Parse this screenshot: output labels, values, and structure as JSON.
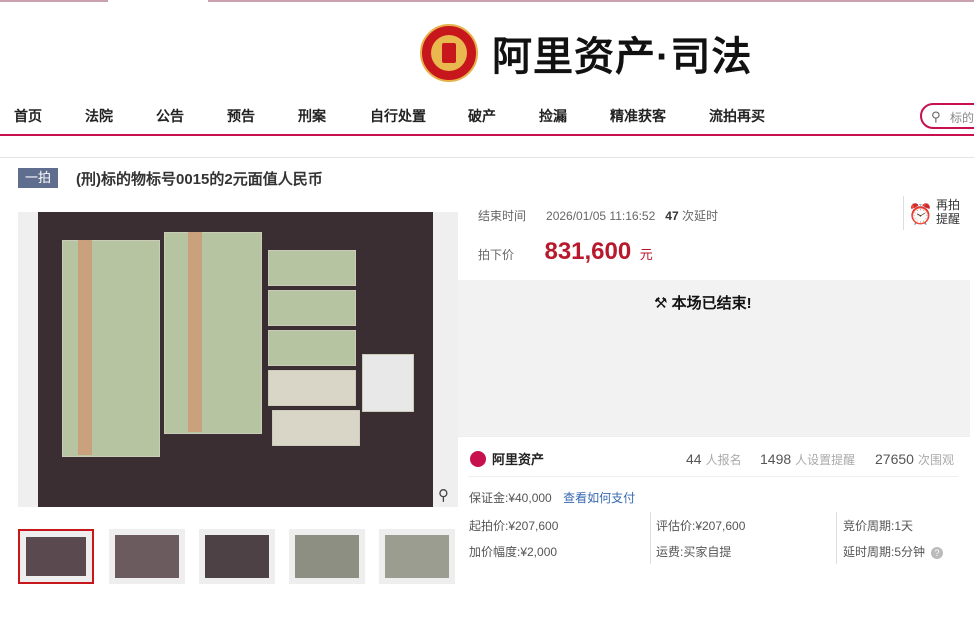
{
  "header": {
    "brand_text": "阿里资产·司法"
  },
  "nav": {
    "items": [
      "首页",
      "法院",
      "公告",
      "预告",
      "刑案",
      "自行处置",
      "破产",
      "捡漏",
      "精准获客",
      "流拍再买"
    ],
    "search_placeholder": "标的"
  },
  "item": {
    "round_tag": "一拍",
    "title": "(刑)标的物标号0015的2元面值人民币",
    "end_label": "结束时间",
    "end_time": "2026/01/05 11:16:52",
    "delay_count": "47",
    "delay_label": "次延时",
    "remind_label": "再拍提醒",
    "price_label": "拍下价",
    "price_value": "831,600",
    "price_unit": "元",
    "ended_message": "本场已结束!"
  },
  "stats": {
    "logo_text": "阿里资产",
    "signups": "44",
    "signups_label": "人报名",
    "reminders": "1498",
    "reminders_label": "人设置提醒",
    "views": "27650",
    "views_label": "次围观"
  },
  "details": {
    "deposit": "保证金:¥40,000",
    "deposit_link": "查看如何支付",
    "start_price": "起拍价:¥207,600",
    "increment": "加价幅度:¥2,000",
    "appraisal": "评估价:¥207,600",
    "shipping": "运费:买家自提",
    "bid_period": "竞价周期:1天",
    "delay_period": "延时周期:5分钟"
  },
  "thumbnails": {
    "count": 5,
    "selected": 0
  }
}
